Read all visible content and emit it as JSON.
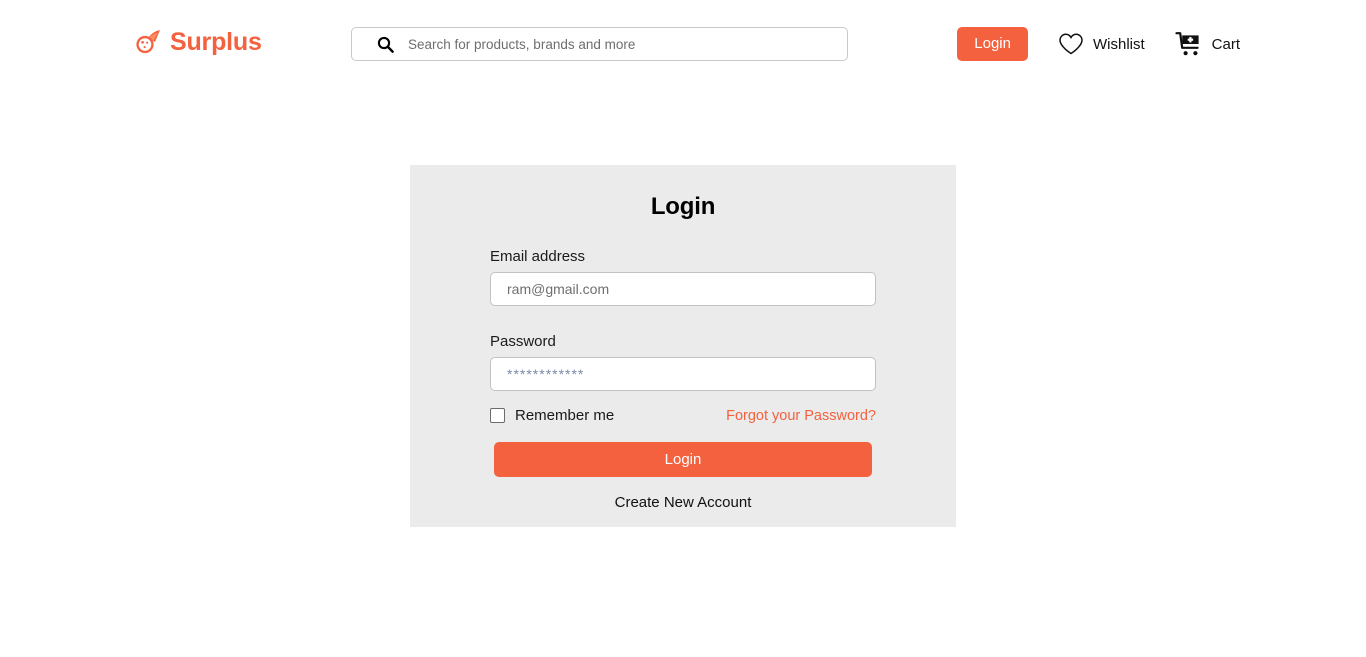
{
  "header": {
    "brand_name": "Surplus",
    "brand_icon": "comet-icon",
    "search": {
      "icon": "search-icon",
      "placeholder": "Search for products, brands and more",
      "value": ""
    },
    "login_label": "Login",
    "wishlist_label": "Wishlist",
    "wishlist_icon": "heart-icon",
    "cart_label": "Cart",
    "cart_icon": "shopping-cart-plus-icon"
  },
  "login_card": {
    "title": "Login",
    "email_label": "Email address",
    "email_placeholder": "ram@gmail.com",
    "email_value": "",
    "password_label": "Password",
    "password_placeholder": "************",
    "password_value": "",
    "remember_label": "Remember me",
    "remember_checked": false,
    "forgot_label": "Forgot your Password?",
    "submit_label": "Login",
    "create_account_label": "Create New Account"
  },
  "colors": {
    "accent": "#F4613E",
    "card_bg": "#EBEBEB",
    "page_bg": "#FFFFFF",
    "text": "#111111"
  }
}
